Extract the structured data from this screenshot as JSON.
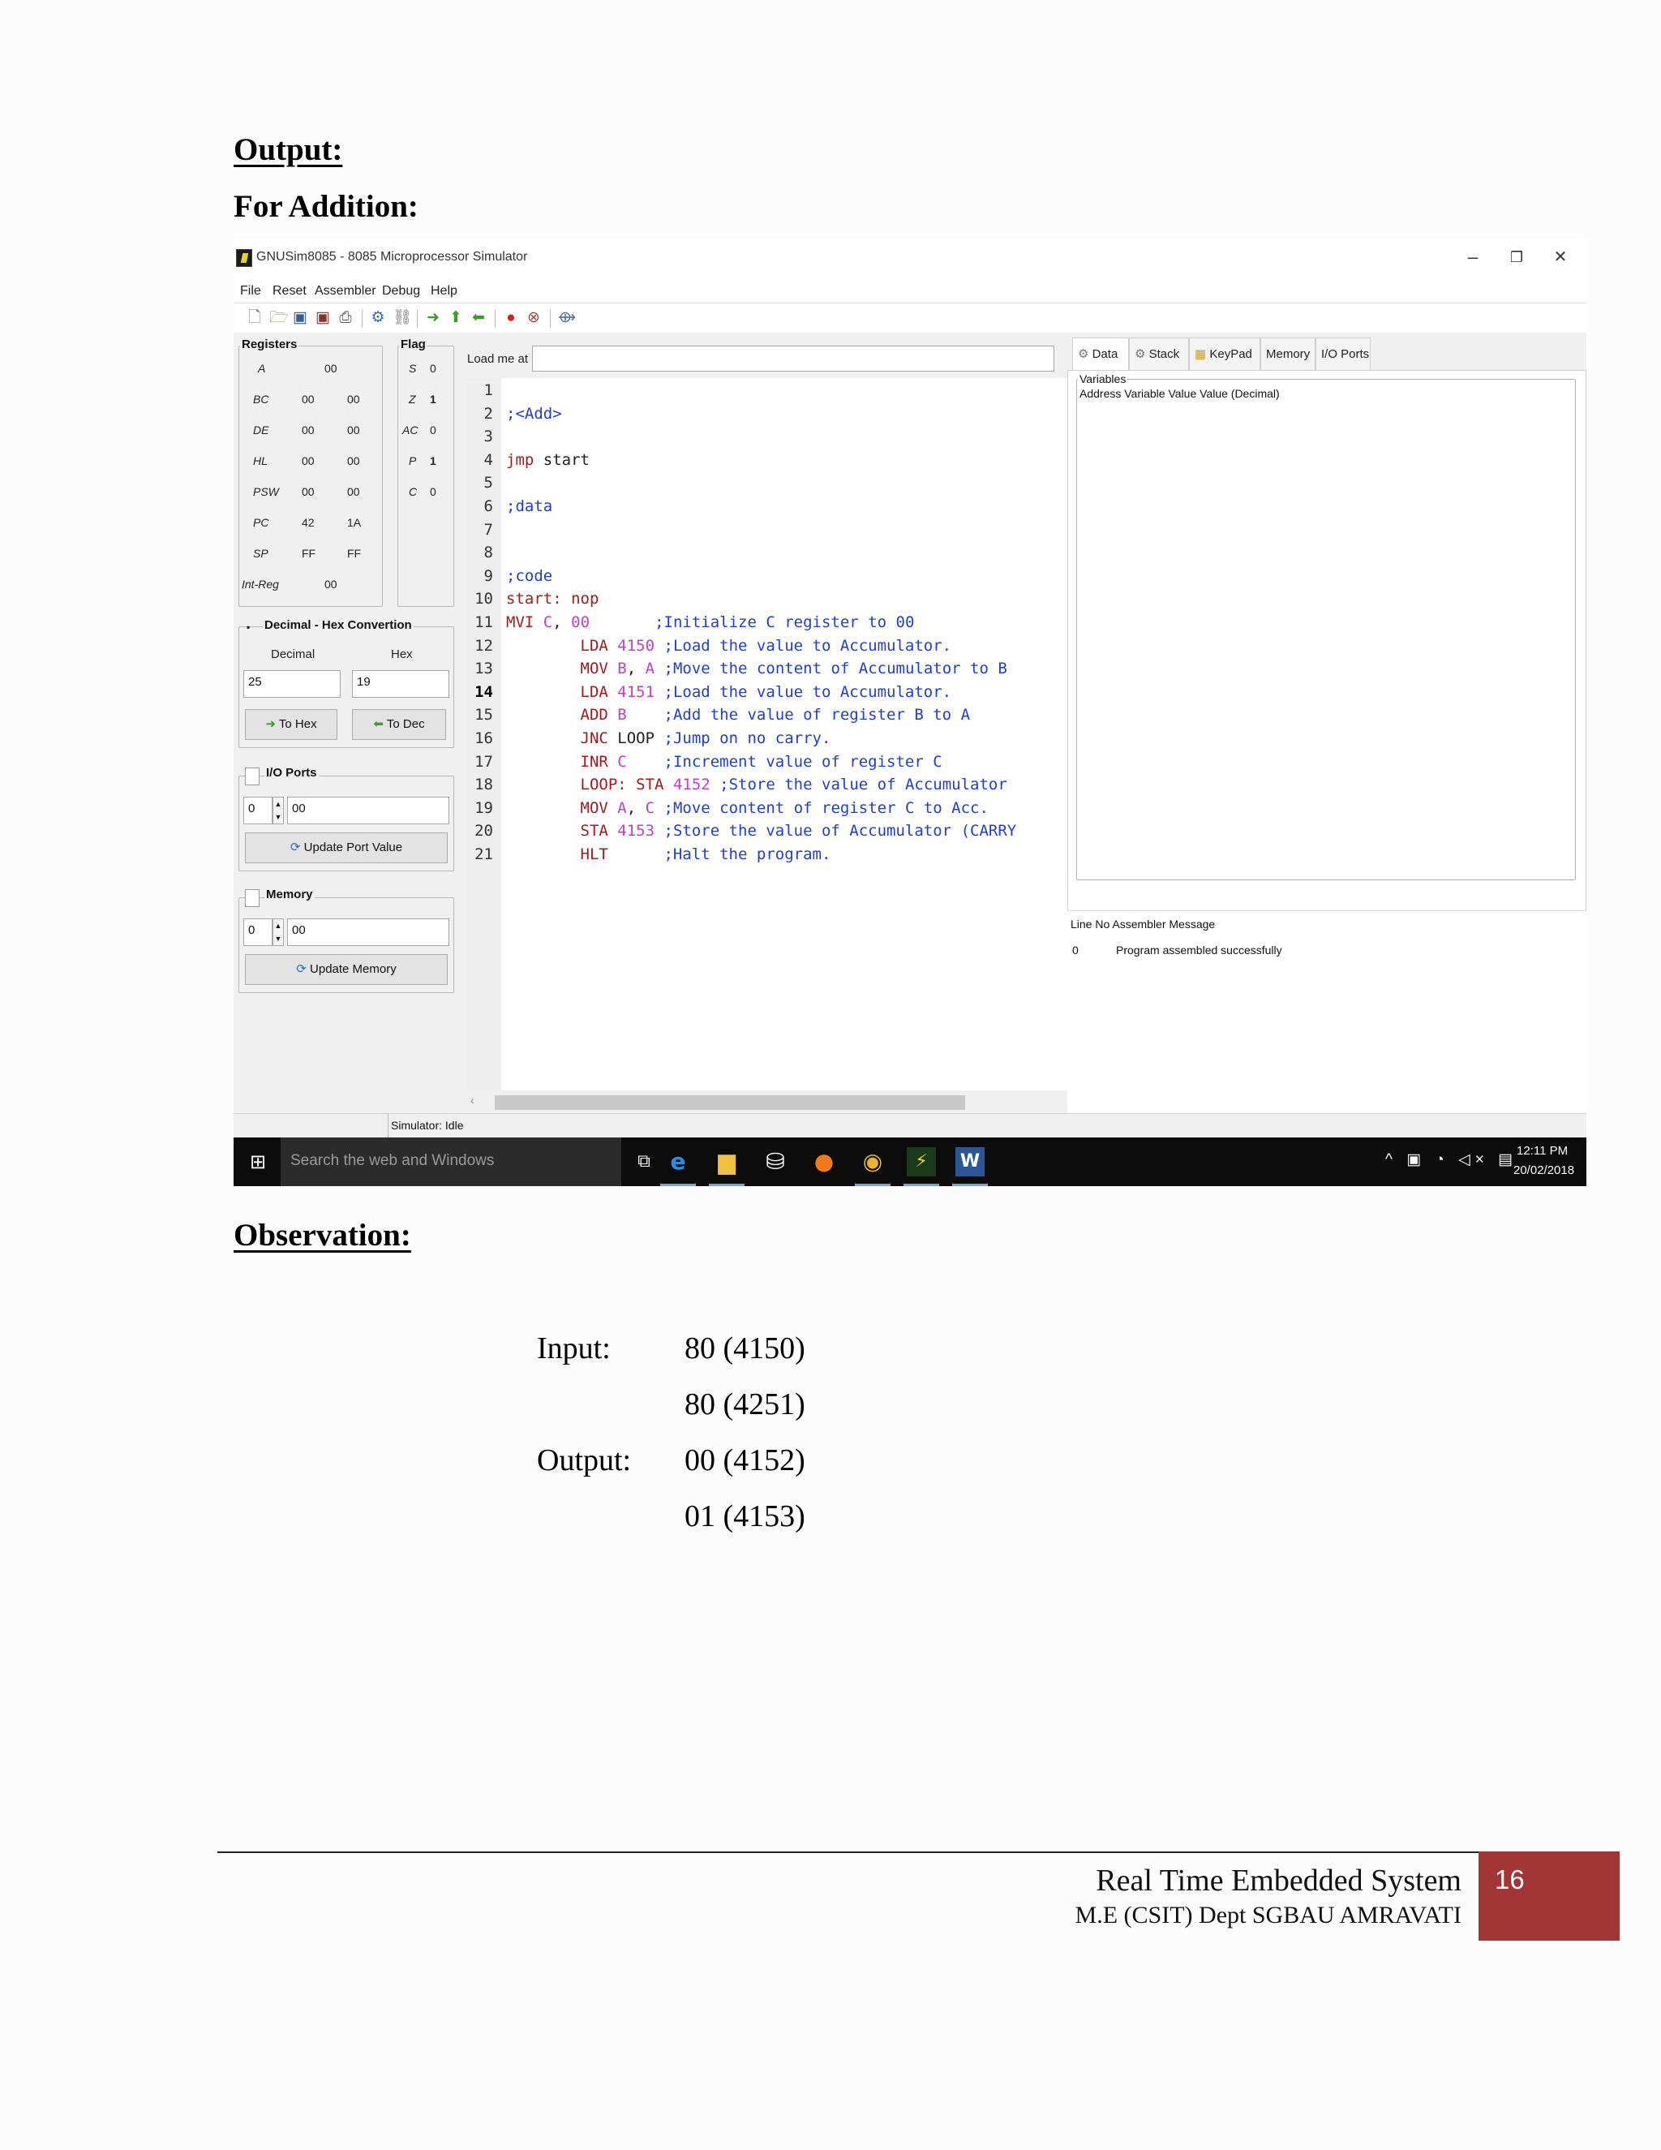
{
  "document": {
    "output_heading": "Output:",
    "subheading": "For Addition:",
    "observation_heading": "Observation:"
  },
  "window": {
    "title": "GNUSim8085 - 8085 Microprocessor Simulator",
    "minimize": "–",
    "restore": "❐",
    "close": "✕"
  },
  "menu": [
    "File",
    "Reset",
    "Assembler",
    "Debug",
    "Help"
  ],
  "toolbar_icons": [
    "new-file-icon",
    "open-folder-icon",
    "save-icon",
    "save-as-icon",
    "print-icon",
    "assemble-icon",
    "link-icon",
    "run-icon",
    "step-up-icon",
    "step-back-icon",
    "breakpoint-icon",
    "stop-icon",
    "settings-icon"
  ],
  "registers": {
    "title": "Registers",
    "rows": [
      {
        "name": "A",
        "v1": "00",
        "v2": ""
      },
      {
        "name": "BC",
        "v1": "00",
        "v2": "00"
      },
      {
        "name": "DE",
        "v1": "00",
        "v2": "00"
      },
      {
        "name": "HL",
        "v1": "00",
        "v2": "00"
      },
      {
        "name": "PSW",
        "v1": "00",
        "v2": "00"
      },
      {
        "name": "PC",
        "v1": "42",
        "v2": "1A"
      },
      {
        "name": "SP",
        "v1": "FF",
        "v2": "FF"
      },
      {
        "name": "Int-Reg",
        "v1": "00",
        "v2": ""
      }
    ]
  },
  "flags": {
    "title": "Flag",
    "rows": [
      {
        "name": "S",
        "value": "0"
      },
      {
        "name": "Z",
        "value": "1"
      },
      {
        "name": "AC",
        "value": "0"
      },
      {
        "name": "P",
        "value": "1"
      },
      {
        "name": "C",
        "value": "0"
      }
    ]
  },
  "converter": {
    "title": "Decimal - Hex Convertion",
    "decimal_label": "Decimal",
    "hex_label": "Hex",
    "decimal_value": "25",
    "hex_value": "19",
    "to_hex": "To Hex",
    "to_dec": "To Dec"
  },
  "io_ports": {
    "title": "I/O Ports",
    "port": "0",
    "value": "00",
    "button": "Update Port Value"
  },
  "memory": {
    "title": "Memory",
    "address": "0",
    "value": "00",
    "button": "Update Memory"
  },
  "editor": {
    "load_label": "Load me at",
    "load_value": "",
    "current_line": 14,
    "lines": [
      {
        "n": "1",
        "code": ""
      },
      {
        "n": "2",
        "code": ";<Add>"
      },
      {
        "n": "3",
        "code": ""
      },
      {
        "n": "4",
        "code": "jmp start"
      },
      {
        "n": "5",
        "code": ""
      },
      {
        "n": "6",
        "code": ";data"
      },
      {
        "n": "7",
        "code": ""
      },
      {
        "n": "8",
        "code": ""
      },
      {
        "n": "9",
        "code": ";code"
      },
      {
        "n": "10",
        "code": "start: nop"
      },
      {
        "n": "11",
        "code": "MVI C, 00       ;Initialize C register to 00"
      },
      {
        "n": "12",
        "code": "        LDA 4150 ;Load the value to Accumulator."
      },
      {
        "n": "13",
        "code": "        MOV B, A ;Move the content of Accumulator to B"
      },
      {
        "n": "14",
        "code": "        LDA 4151 ;Load the value to Accumulator."
      },
      {
        "n": "15",
        "code": "        ADD B    ;Add the value of register B to A"
      },
      {
        "n": "16",
        "code": "        JNC LOOP ;Jump on no carry."
      },
      {
        "n": "17",
        "code": "        INR C    ;Increment value of register C"
      },
      {
        "n": "18",
        "code": "        LOOP: STA 4152 ;Store the value of Accumulator"
      },
      {
        "n": "19",
        "code": "        MOV A, C ;Move content of register C to Acc."
      },
      {
        "n": "20",
        "code": "        STA 4153 ;Store the value of Accumulator (CARRY"
      },
      {
        "n": "21",
        "code": "        HLT      ;Halt the program."
      }
    ]
  },
  "right_tabs": [
    "Data",
    "Stack",
    "KeyPad",
    "Memory",
    "I/O Ports"
  ],
  "variables": {
    "title": "Variables",
    "header": "Address Variable Value Value (Decimal)"
  },
  "messages": {
    "header": "Line No Assembler Message",
    "line_no": "0",
    "message": "Program assembled successfully"
  },
  "status": "Simulator: Idle",
  "taskbar": {
    "search_placeholder": "Search the web and Windows",
    "time": "12:11 PM",
    "date": "20/02/2018",
    "tray": "^ ▣ ◔ ◁× ▤"
  },
  "observation": {
    "input_label": "Input:",
    "output_label": "Output:",
    "inputs": [
      "80 (4150)",
      "80 (4251)"
    ],
    "outputs": [
      "00 (4152)",
      "01 (4153)"
    ]
  },
  "footer": {
    "title": "Real Time Embedded System",
    "dept": "M.E (CSIT)  Dept SGBAU AMRAVATI",
    "page": "16"
  }
}
